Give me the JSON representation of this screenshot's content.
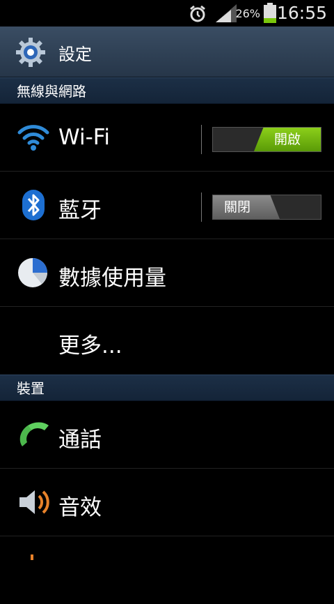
{
  "status_bar": {
    "battery_percent": "26%",
    "time": "16:55",
    "icons": [
      "alarm-icon",
      "signal-icon",
      "battery-icon"
    ]
  },
  "title_bar": {
    "title": "設定",
    "icon": "gear-icon"
  },
  "sections": [
    {
      "header": "無線與網路",
      "items": [
        {
          "label": "Wi-Fi",
          "icon": "wifi-icon",
          "toggle": "開啟",
          "toggle_on": true
        },
        {
          "label": "藍牙",
          "icon": "bluetooth-icon",
          "toggle": "關閉",
          "toggle_on": false
        },
        {
          "label": "數據使用量",
          "icon": "data-usage-icon"
        },
        {
          "label": "更多..."
        }
      ]
    },
    {
      "header": "裝置",
      "items": [
        {
          "label": "通話",
          "icon": "phone-icon"
        },
        {
          "label": "音效",
          "icon": "speaker-icon"
        }
      ]
    }
  ],
  "colors": {
    "toggle_on": "#7ab81a",
    "title_bar": "#2f4258",
    "section_header": "#1a2c42"
  }
}
